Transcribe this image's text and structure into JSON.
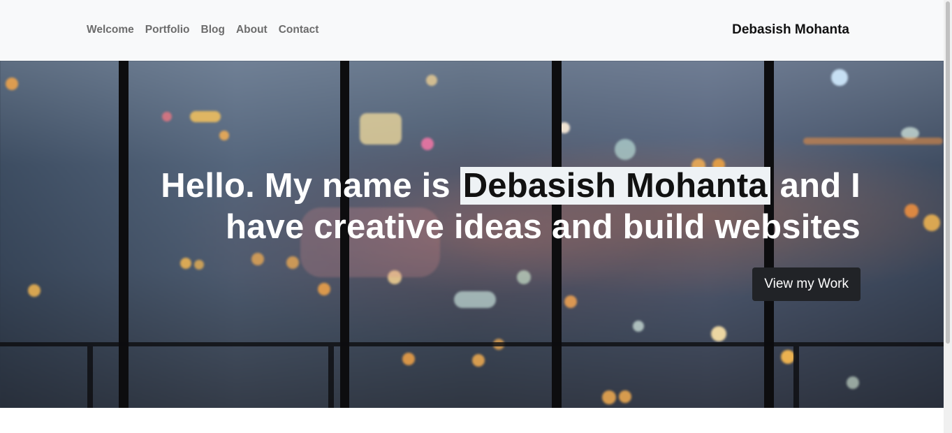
{
  "nav": {
    "links": [
      "Welcome",
      "Portfolio",
      "Blog",
      "About",
      "Contact"
    ],
    "brand": "Debasish Mohanta"
  },
  "hero": {
    "intro": "Hello. My name is",
    "name": "Debasish Mohanta",
    "outro": "and I have creative ideas and build websites",
    "cta_label": "View my Work"
  },
  "colors": {
    "navbar_bg": "#f8f9fa",
    "nav_link": "#6c6c6c",
    "brand": "#111111",
    "highlight_bg": "#eef2f5",
    "cta_bg": "#212327"
  }
}
